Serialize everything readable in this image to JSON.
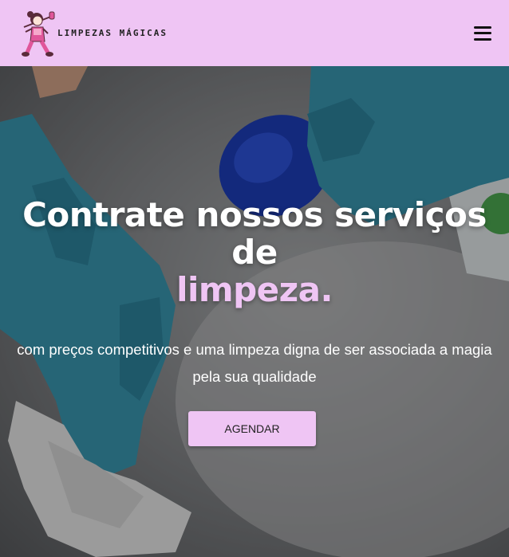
{
  "header": {
    "brand": "LIMPEZAS MÁGICAS",
    "logo_icon": "cleaning-lady-mascot-icon",
    "menu_icon": "hamburger-menu-icon"
  },
  "hero": {
    "title_line1": "Contrate nossos serviços",
    "title_line2": "de",
    "title_highlight": "limpeza.",
    "subtitle_line1": "com preços competitivos e uma limpeza digna de ser associada a magia",
    "subtitle_line2": "pela sua qualidade",
    "cta_label": "AGENDAR"
  },
  "colors": {
    "accent": "#efc5f4",
    "header_bg": "#efc5f4",
    "glove": "#3b9bb6"
  }
}
